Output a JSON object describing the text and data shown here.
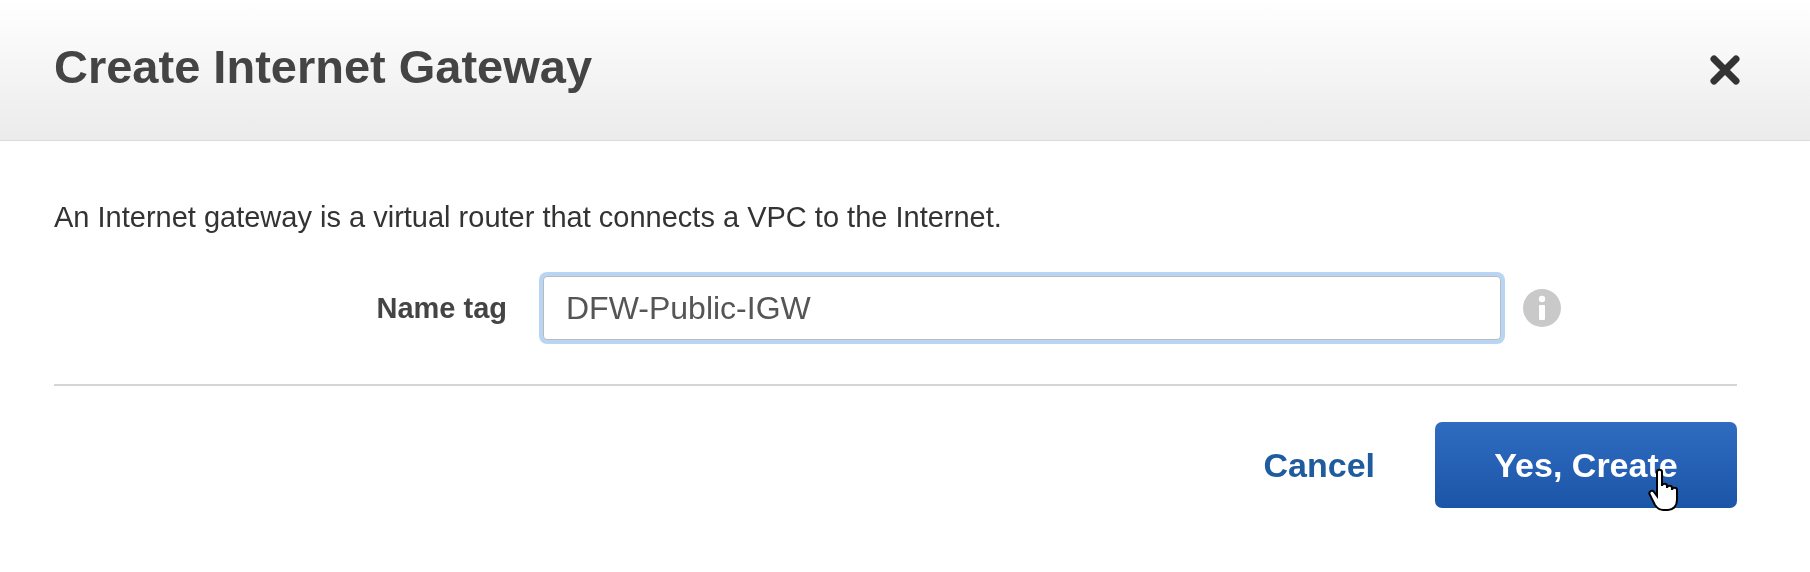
{
  "dialog": {
    "title": "Create Internet Gateway",
    "description": "An Internet gateway is a virtual router that connects a VPC to the Internet.",
    "field": {
      "label": "Name tag",
      "value": "DFW-Public-IGW",
      "focused": true
    },
    "buttons": [
      {
        "label": "Cancel",
        "kind": "link"
      },
      {
        "label": "Yes, Create",
        "kind": "primary"
      }
    ]
  }
}
